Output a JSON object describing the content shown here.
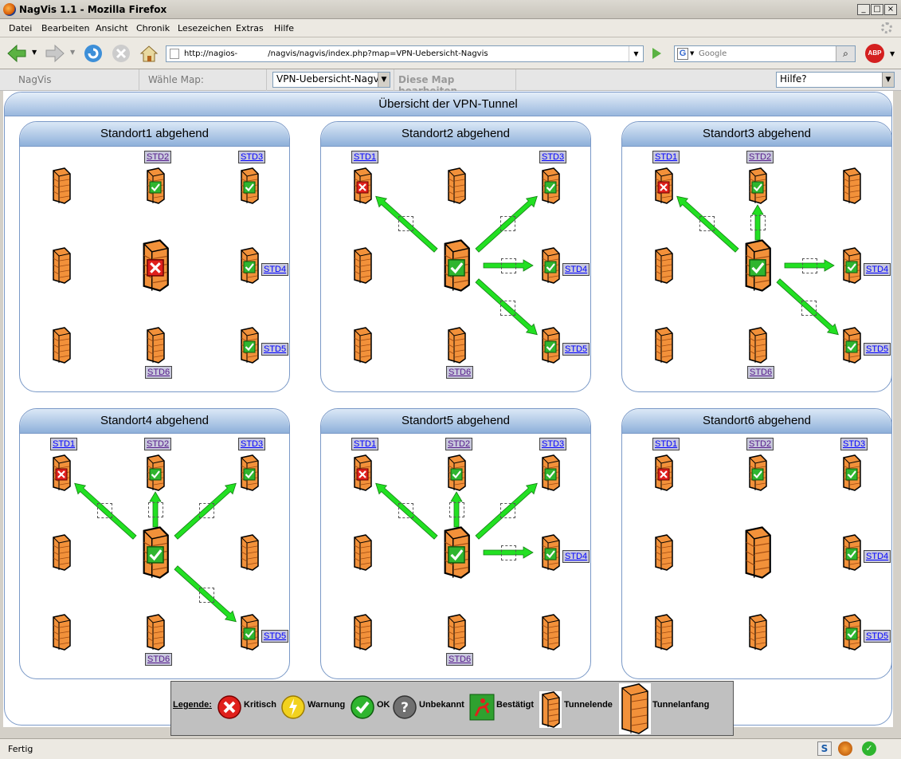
{
  "window": {
    "title": "NagVis 1.1 - Mozilla Firefox"
  },
  "menu": [
    "Datei",
    "Bearbeiten",
    "Ansicht",
    "Chronik",
    "Lesezeichen",
    "Extras",
    "Hilfe"
  ],
  "browser": {
    "url": "http://nagios-            /nagvis/nagvis/index.php?map=VPN-Uebersicht-Nagvis",
    "search_placeholder": "Google",
    "status": "Fertig"
  },
  "nagvis": {
    "brand": "NagVis",
    "choose_map_label": "Wähle Map:",
    "map_select": "VPN-Uebersicht-Nagvis",
    "edit_map": "Diese Map bearbeiten",
    "help": "Hilfe?"
  },
  "map": {
    "title": "Übersicht der VPN-Tunnel"
  },
  "panels": [
    {
      "title": "Standort1 abgehend",
      "center_state": "critical",
      "nodes": [
        "none",
        "ok",
        "ok",
        "none",
        "center",
        "ok",
        "none",
        "none",
        "ok"
      ],
      "labels": {
        "1": "STD2",
        "2": "STD3",
        "5": "STD4",
        "8": "STD5",
        "7": "STD6"
      },
      "arrows": []
    },
    {
      "title": "Standort2 abgehend",
      "center_state": "ok",
      "nodes": [
        "critical",
        "none",
        "ok",
        "none",
        "center",
        "ok",
        "none",
        "none",
        "ok"
      ],
      "labels": {
        "0": "STD1",
        "2": "STD3",
        "5": "STD4",
        "8": "STD5",
        "7": "STD6"
      },
      "arrows": [
        0,
        2,
        5,
        8
      ]
    },
    {
      "title": "Standort3 abgehend",
      "center_state": "ok",
      "nodes": [
        "critical",
        "ok",
        "none",
        "none",
        "center",
        "ok",
        "none",
        "none",
        "ok"
      ],
      "labels": {
        "0": "STD1",
        "1": "STD2",
        "5": "STD4",
        "8": "STD5",
        "7": "STD6"
      },
      "arrows": [
        0,
        1,
        5,
        8
      ]
    },
    {
      "title": "Standort4 abgehend",
      "center_state": "ok",
      "nodes": [
        "critical",
        "ok",
        "ok",
        "none",
        "center",
        "none",
        "none",
        "none",
        "ok"
      ],
      "labels": {
        "0": "STD1",
        "1": "STD2",
        "2": "STD3",
        "8": "STD5",
        "7": "STD6"
      },
      "arrows": [
        0,
        1,
        2,
        8
      ]
    },
    {
      "title": "Standort5 abgehend",
      "center_state": "ok",
      "nodes": [
        "critical",
        "ok",
        "ok",
        "none",
        "center",
        "ok",
        "none",
        "none",
        "none"
      ],
      "labels": {
        "0": "STD1",
        "1": "STD2",
        "2": "STD3",
        "5": "STD4",
        "7": "STD6"
      },
      "arrows": [
        0,
        1,
        2,
        5
      ]
    },
    {
      "title": "Standort6 abgehend",
      "center_state": "none",
      "nodes": [
        "critical",
        "ok",
        "ok",
        "none",
        "center",
        "ok",
        "none",
        "none",
        "ok"
      ],
      "labels": {
        "0": "STD1",
        "1": "STD2",
        "2": "STD3",
        "5": "STD4",
        "8": "STD5"
      },
      "arrows": []
    }
  ],
  "legend": {
    "title": "Legende:",
    "items": [
      "Kritisch",
      "Warnung",
      "OK",
      "Unbekannt",
      "Bestätigt",
      "Tunnelende",
      "Tunnelanfang"
    ]
  },
  "colors": {
    "ok": "#2fb52f",
    "critical": "#e0201c",
    "warning": "#f2d21e",
    "unknown": "#707070",
    "arrow": "#22e022",
    "firewall": "#f2913a",
    "panel_header": "#9ab8de"
  }
}
